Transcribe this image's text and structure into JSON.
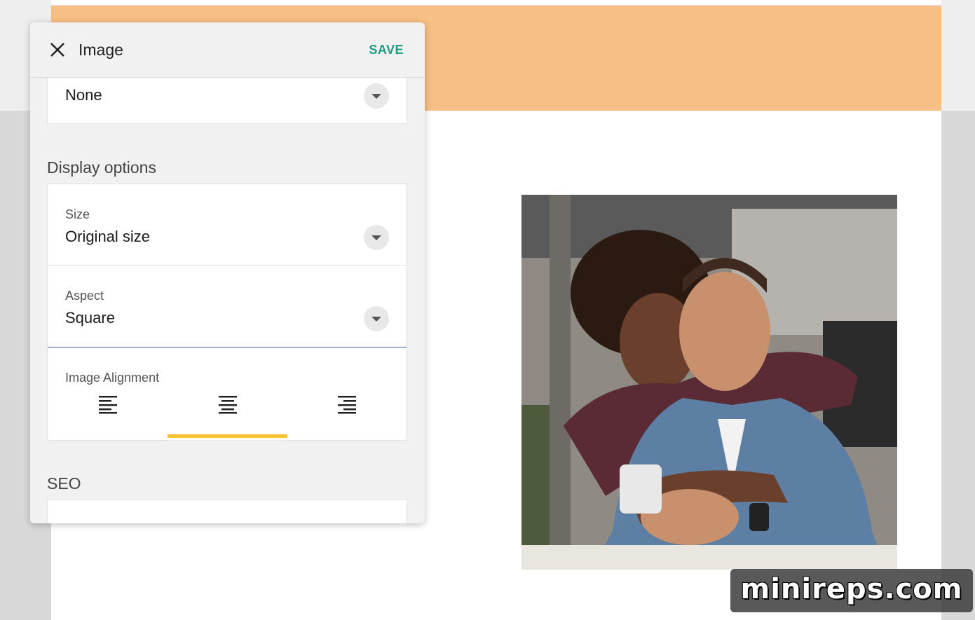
{
  "panel": {
    "title": "Image",
    "save_label": "SAVE",
    "link_field": {
      "value": "None"
    },
    "display_options": {
      "title": "Display options",
      "size": {
        "label": "Size",
        "value": "Original size"
      },
      "aspect": {
        "label": "Aspect",
        "value": "Square"
      },
      "alignment": {
        "label": "Image Alignment",
        "options": [
          "align-left",
          "align-center",
          "align-right"
        ],
        "selected": "align-center"
      }
    },
    "seo": {
      "title": "SEO"
    }
  },
  "watermark": {
    "text": "minireps.com"
  },
  "colors": {
    "banner": "#f8bf84",
    "accent_save": "#1d9c86",
    "active_tab": "#f5c530"
  }
}
